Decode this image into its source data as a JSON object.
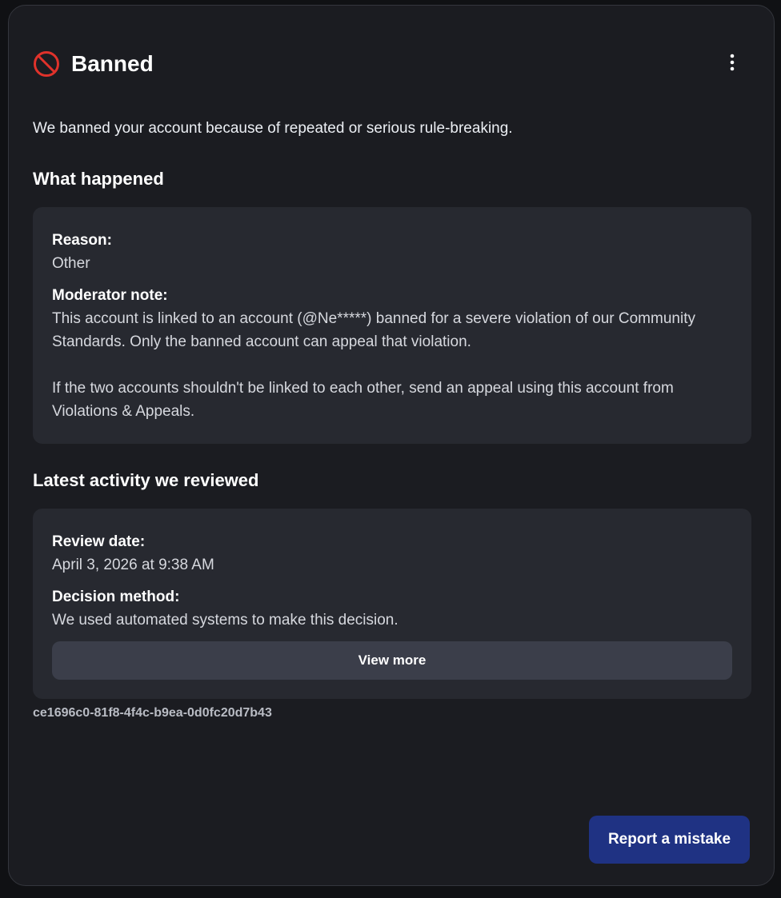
{
  "colors": {
    "ban_icon": "#e0322b",
    "primary_button": "#1f3283",
    "card_background": "#272930",
    "modal_background": "#1b1c21"
  },
  "header": {
    "icon": "ban-icon",
    "title": "Banned",
    "menu_icon": "more-vertical-icon"
  },
  "summary": "We banned your account because of repeated or serious rule-breaking.",
  "what_happened": {
    "heading": "What happened",
    "reason_label": "Reason:",
    "reason_value": "Other",
    "note_label": "Moderator note:",
    "note_paragraph_1": "This account is linked to an account (@Ne*****) banned for a severe violation of our Community Standards. Only the banned account can appeal that violation.",
    "note_paragraph_2": "If the two accounts shouldn't be linked to each other, send an appeal using this account from Violations & Appeals."
  },
  "latest_activity": {
    "heading": "Latest activity we reviewed",
    "review_date_label": "Review date:",
    "review_date_value": "April 3, 2026 at 9:38 AM",
    "decision_method_label": "Decision method:",
    "decision_method_value": "We used automated systems to make this decision.",
    "view_more_label": "View more"
  },
  "reference_id": "ce1696c0-81f8-4f4c-b9ea-0d0fc20d7b43",
  "footer": {
    "report_button_label": "Report a mistake"
  }
}
